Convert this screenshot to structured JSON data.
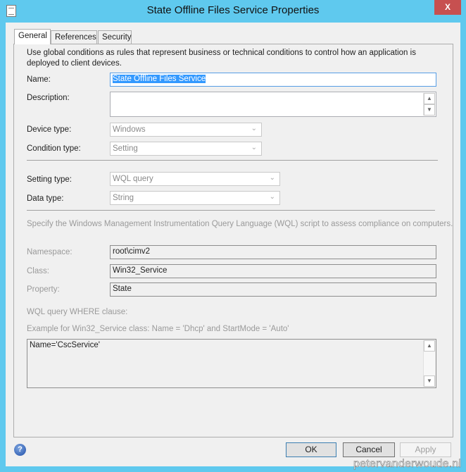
{
  "window": {
    "title": "State Offline Files Service Properties",
    "close_label": "X"
  },
  "tabs": [
    {
      "label": "General"
    },
    {
      "label": "References"
    },
    {
      "label": "Security"
    }
  ],
  "general": {
    "intro": "Use global conditions as rules that represent business or technical conditions to control how an application is deployed to client devices.",
    "name_label": "Name:",
    "name_value": "State Offline Files Service",
    "description_label": "Description:",
    "description_value": "",
    "device_type_label": "Device type:",
    "device_type_value": "Windows",
    "condition_type_label": "Condition type:",
    "condition_type_value": "Setting",
    "setting_type_label": "Setting type:",
    "setting_type_value": "WQL query",
    "data_type_label": "Data type:",
    "data_type_value": "String",
    "wql_instructions": "Specify the Windows Management Instrumentation Query Language (WQL) script to assess compliance on computers.",
    "namespace_label": "Namespace:",
    "namespace_value": "root\\cimv2",
    "class_label": "Class:",
    "class_value": "Win32_Service",
    "property_label": "Property:",
    "property_value": "State",
    "where_label": "WQL query WHERE clause:",
    "where_example": "Example for Win32_Service class: Name = 'Dhcp' and StartMode = 'Auto'",
    "where_value": "Name='CscService'"
  },
  "buttons": {
    "ok": "OK",
    "cancel": "Cancel",
    "apply": "Apply"
  },
  "watermark": "petervanderwoude.nl",
  "colors": {
    "frame": "#5fc9ee",
    "close": "#c75050",
    "selection": "#3399ff"
  }
}
